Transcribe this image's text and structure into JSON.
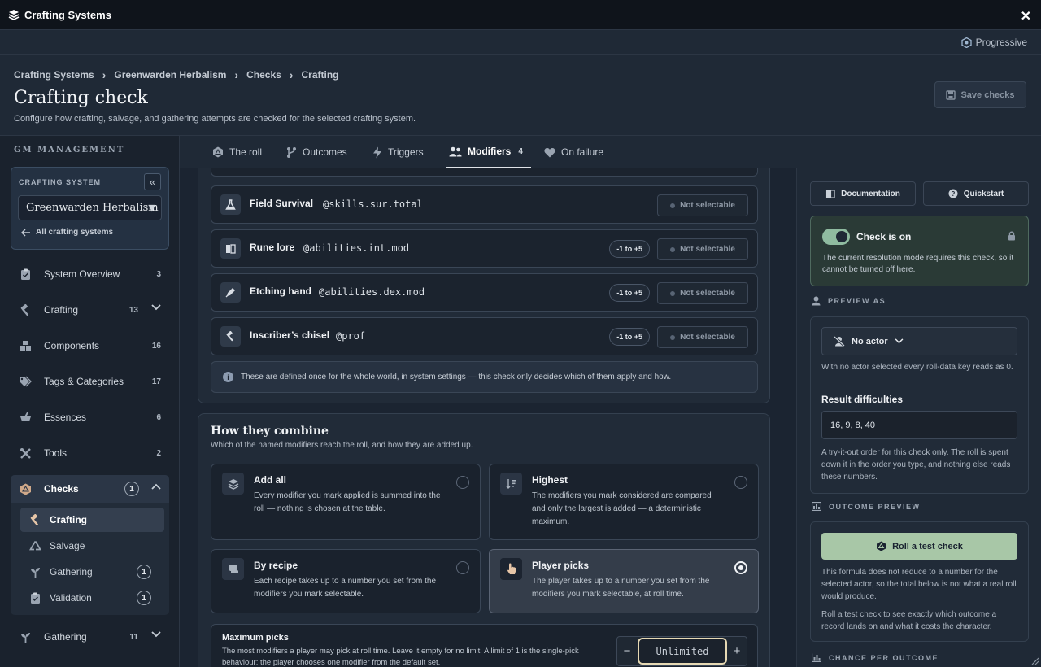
{
  "window": {
    "title": "Crafting Systems",
    "close_label": "✕"
  },
  "mode": {
    "label": "Progressive"
  },
  "header": {
    "breadcrumbs": [
      "Crafting Systems",
      "Greenwarden Herbalism",
      "Checks",
      "Crafting"
    ],
    "title": "Crafting check",
    "subtitle": "Configure how crafting, salvage, and gathering attempts are checked for the selected crafting system.",
    "save_label": "Save checks"
  },
  "sidebar": {
    "section_label": "GM MANAGEMENT",
    "crafting_system_label": "CRAFTING SYSTEM",
    "selected_system": "Greenwarden Herbalism",
    "all_systems_label": "All crafting systems",
    "items": [
      {
        "label": "System Overview",
        "count": "3"
      },
      {
        "label": "Crafting",
        "count": "13"
      },
      {
        "label": "Components",
        "count": "16"
      },
      {
        "label": "Tags & Categories",
        "count": "17"
      },
      {
        "label": "Essences",
        "count": "6"
      },
      {
        "label": "Tools",
        "count": "2"
      },
      {
        "label": "Checks",
        "count": "1"
      },
      {
        "label": "Gathering",
        "count": "11"
      }
    ],
    "check_subitems": [
      {
        "label": "Crafting",
        "count": ""
      },
      {
        "label": "Salvage",
        "count": ""
      },
      {
        "label": "Gathering",
        "count": "1"
      },
      {
        "label": "Validation",
        "count": "1"
      }
    ]
  },
  "tabs": [
    {
      "label": "The roll"
    },
    {
      "label": "Outcomes"
    },
    {
      "label": "Triggers"
    },
    {
      "label": "Modifiers",
      "badge": "4"
    },
    {
      "label": "On failure"
    }
  ],
  "modifiers": {
    "rows": [
      {
        "name": "Field Survival",
        "formula": "@skills.sur.total",
        "range": "",
        "selectable": "Not selectable"
      },
      {
        "name": "Rune lore",
        "formula": "@abilities.int.mod",
        "range": "-1 to +5",
        "selectable": "Not selectable"
      },
      {
        "name": "Etching hand",
        "formula": "@abilities.dex.mod",
        "range": "-1 to +5",
        "selectable": "Not selectable"
      },
      {
        "name": "Inscriber’s chisel",
        "formula": "@prof",
        "range": "-1 to +5",
        "selectable": "Not selectable"
      }
    ],
    "info": "These are defined once for the whole world, in system settings — this check only decides which of them apply and how."
  },
  "combine": {
    "title": "How they combine",
    "subtitle": "Which of the named modifiers reach the roll, and how they are added up.",
    "options": [
      {
        "title": "Add all",
        "desc": "Every modifier you mark applied is summed into the roll — nothing is chosen at the table.",
        "selected": false
      },
      {
        "title": "Highest",
        "desc": "The modifiers you mark considered are compared and only the largest is added — a deterministic maximum.",
        "selected": false
      },
      {
        "title": "By recipe",
        "desc": "Each recipe takes up to a number you set from the modifiers you mark selectable.",
        "selected": false
      },
      {
        "title": "Player picks",
        "desc": "The player takes up to a number you set from the modifiers you mark selectable, at roll time.",
        "selected": true
      }
    ],
    "max_picks": {
      "title": "Maximum picks",
      "desc": "The most modifiers a player may pick at roll time. Leave it empty for no limit. A limit of 1 is the single-pick behaviour: the player chooses one modifier from the default set.",
      "value": "Unlimited",
      "minus": "−",
      "plus": "+"
    }
  },
  "right": {
    "documentation_label": "Documentation",
    "quickstart_label": "Quickstart",
    "check_on_title": "Check is on",
    "check_on_desc": "The current resolution mode requires this check, so it cannot be turned off here.",
    "preview_as_label": "PREVIEW AS",
    "actor_label": "No actor",
    "actor_note": "With no actor selected every roll-data key reads as 0.",
    "result_difficulties_label": "Result difficulties",
    "result_difficulties_value": "16, 9, 8, 40",
    "rd_note": "A try-it-out order for this check only. The roll is spent down it in the order you type, and nothing else reads these numbers.",
    "outcome_preview_label": "OUTCOME PREVIEW",
    "roll_button_label": "Roll a test check",
    "outcome_note1": "This formula does not reduce to a number for the selected actor, so the total below is not what a real roll would produce.",
    "outcome_note2": "Roll a test check to see exactly which outcome a record lands on and what it costs the character.",
    "chance_label": "CHANCE PER OUTCOME"
  }
}
